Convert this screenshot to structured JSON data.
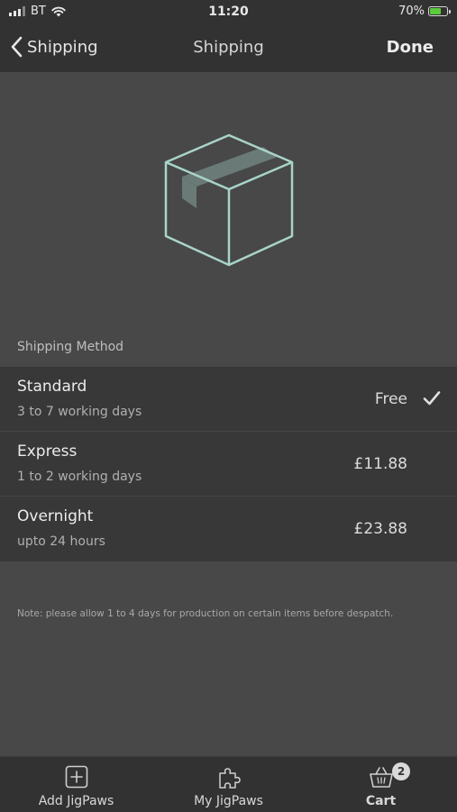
{
  "status_bar": {
    "carrier": "BT",
    "time": "11:20",
    "battery_text": "70%",
    "battery_level": 0.7
  },
  "nav": {
    "back_label": "Shipping",
    "title": "Shipping",
    "done_label": "Done"
  },
  "hero": {
    "icon": "package-box-icon"
  },
  "shipping": {
    "section_label": "Shipping Method",
    "methods": [
      {
        "name": "Standard",
        "description": "3 to 7 working days",
        "price": "Free",
        "selected": true
      },
      {
        "name": "Express",
        "description": "1 to 2 working days",
        "price": "£11.88",
        "selected": false
      },
      {
        "name": "Overnight",
        "description": "upto 24 hours",
        "price": "£23.88",
        "selected": false
      }
    ],
    "note": "Note: please allow 1 to 4 days for production on certain items before despatch."
  },
  "tabs": [
    {
      "label": "Add JigPaws",
      "icon": "add-square-icon"
    },
    {
      "label": "My JigPaws",
      "icon": "puzzle-piece-icon"
    },
    {
      "label": "Cart",
      "icon": "basket-icon",
      "badge": "2"
    }
  ],
  "colors": {
    "background": "#484848",
    "bars": "#323232",
    "list_background": "#383838",
    "box_outline": "#a9d4c9",
    "box_tape": "#6a7a77",
    "battery_fill": "#5ccb3c"
  }
}
